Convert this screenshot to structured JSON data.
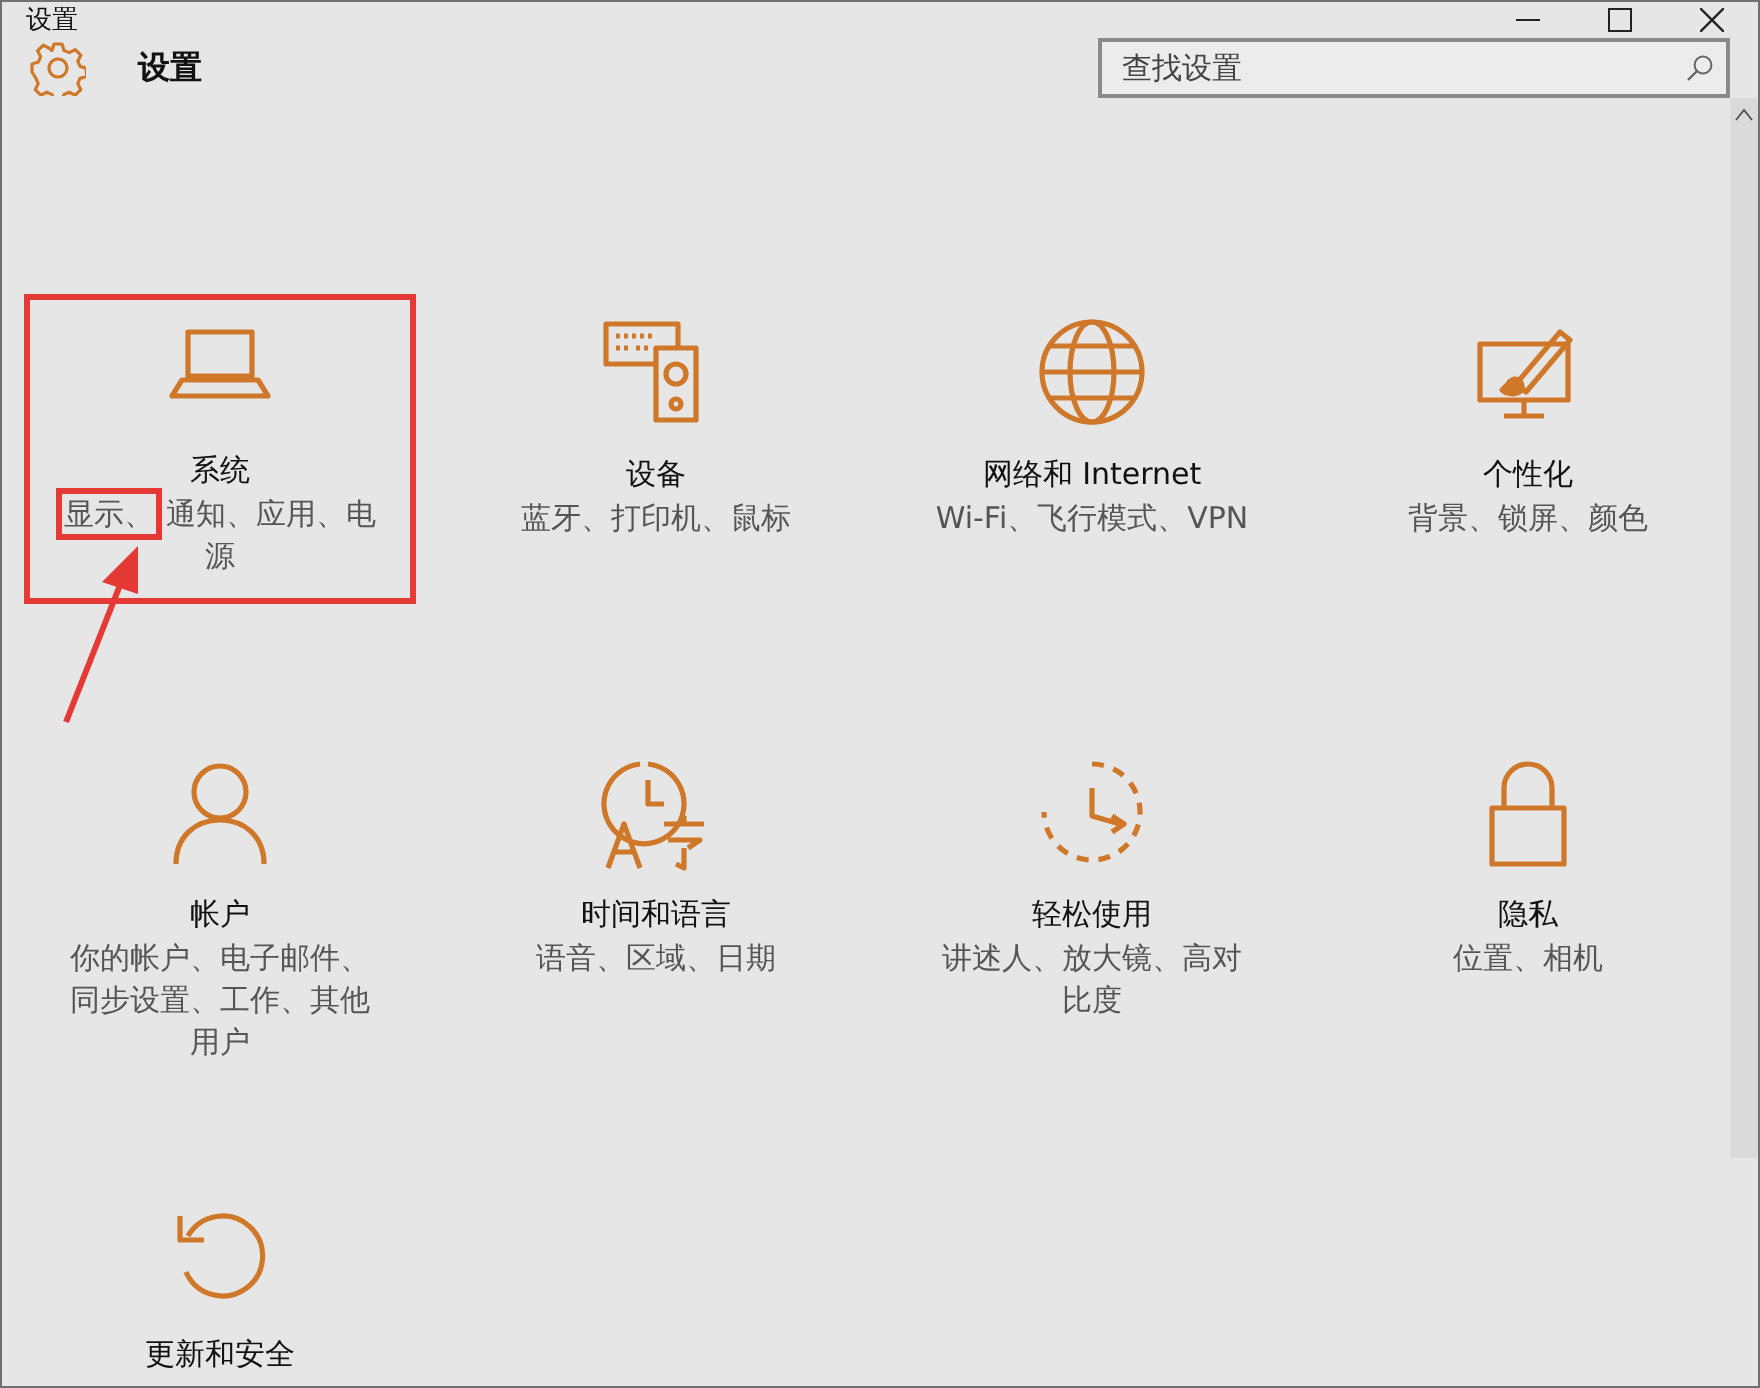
{
  "window": {
    "title": "设置"
  },
  "header": {
    "title": "设置"
  },
  "search": {
    "placeholder": "查找设置"
  },
  "tiles": [
    {
      "kind": "system",
      "title": "系统",
      "subtitle_marked": "显示、",
      "subtitle": "通知、应用、电源",
      "annotated": true
    },
    {
      "kind": "devices",
      "title": "设备",
      "subtitle": "蓝牙、打印机、鼠标",
      "annotated": false
    },
    {
      "kind": "network",
      "title": "网络和 Internet",
      "subtitle": "Wi-Fi、飞行模式、VPN",
      "annotated": false
    },
    {
      "kind": "personalization",
      "title": "个性化",
      "subtitle": "背景、锁屏、颜色",
      "annotated": false
    },
    {
      "kind": "accounts",
      "title": "帐户",
      "subtitle": "你的帐户、电子邮件、同步设置、工作、其他用户",
      "annotated": false
    },
    {
      "kind": "time",
      "title": "时间和语言",
      "subtitle": "语音、区域、日期",
      "annotated": false
    },
    {
      "kind": "ease",
      "title": "轻松使用",
      "subtitle": "讲述人、放大镜、高对比度",
      "annotated": false
    },
    {
      "kind": "privacy",
      "title": "隐私",
      "subtitle": "位置、相机",
      "annotated": false
    },
    {
      "kind": "update",
      "title": "更新和安全",
      "annotated": false
    }
  ]
}
